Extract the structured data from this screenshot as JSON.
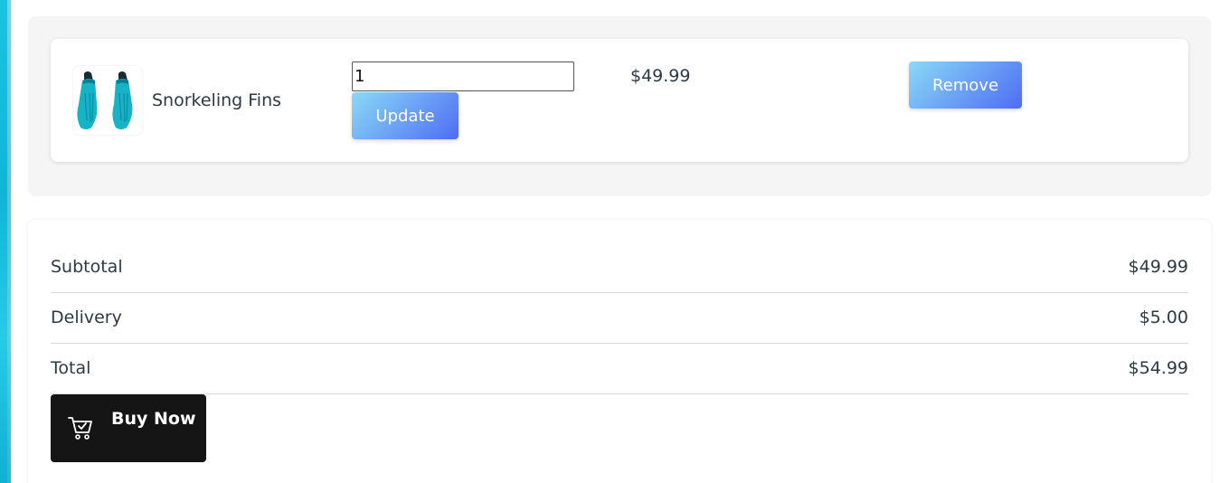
{
  "cart": {
    "items": [
      {
        "name": "Snorkeling Fins",
        "image_icon": "snorkeling-fins-image",
        "quantity": "1",
        "update_label": "Update",
        "price": "$49.99",
        "remove_label": "Remove"
      }
    ]
  },
  "summary": {
    "subtotal_label": "Subtotal",
    "subtotal_value": "$49.99",
    "delivery_label": "Delivery",
    "delivery_value": "$5.00",
    "total_label": "Total",
    "total_value": "$54.99"
  },
  "buy_button": {
    "label": "Buy Now",
    "icon": "cart-check-icon"
  },
  "colors": {
    "button_gradient_start": "#8ad9f6",
    "button_gradient_end": "#4f6cf5",
    "buy_button_bg": "#151515",
    "panel_bg": "#f5f5f5",
    "text": "#2c3a44"
  }
}
